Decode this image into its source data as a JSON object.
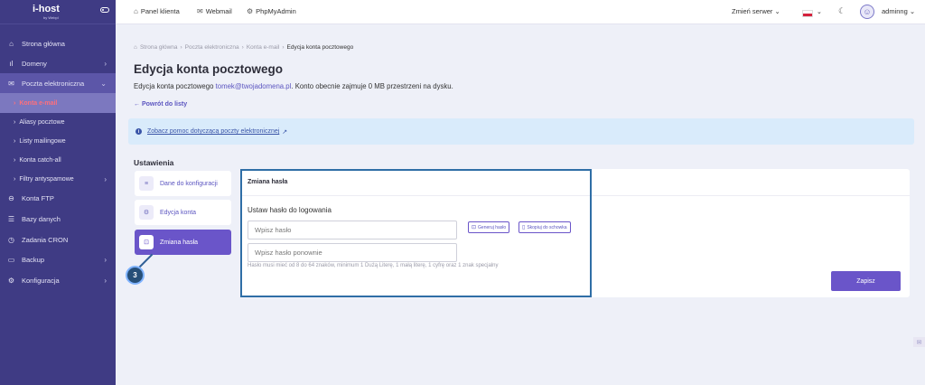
{
  "brand": {
    "logo": "i-host",
    "logo_sub": "by Webpl"
  },
  "sidebar": {
    "items": [
      {
        "label": "Strona główna",
        "icon": "home-icon"
      },
      {
        "label": "Domeny",
        "icon": "chart-icon"
      },
      {
        "label": "Poczta elektroniczna",
        "icon": "mail-icon"
      },
      {
        "label": "Konta e-mail"
      },
      {
        "label": "Aliasy pocztowe"
      },
      {
        "label": "Listy mailingowe"
      },
      {
        "label": "Konta catch-all"
      },
      {
        "label": "Filtry antyspamowe"
      },
      {
        "label": "Konta FTP",
        "icon": "ftp-icon"
      },
      {
        "label": "Bazy danych",
        "icon": "database-icon"
      },
      {
        "label": "Zadania CRON",
        "icon": "clock-icon"
      },
      {
        "label": "Backup",
        "icon": "backup-icon"
      },
      {
        "label": "Konfiguracja",
        "icon": "gear-icon"
      }
    ]
  },
  "topbar": {
    "panel_klienta": "Panel klienta",
    "webmail": "Webmail",
    "phpmyadmin": "PhpMyAdmin",
    "server_switch": "Zmień serwer",
    "username": "adminng"
  },
  "breadcrumb": {
    "home": "Strona główna",
    "level1": "Poczta elektroniczna",
    "level2": "Konta e-mail",
    "current": "Edycja konta pocztowego"
  },
  "page": {
    "title": "Edycja konta pocztowego",
    "desc_prefix": "Edycja konta pocztowego",
    "email": "tomek@twojadomena.pl",
    "desc_suffix": ". Konto obecnie zajmuje 0 MB przestrzeni na dysku.",
    "back_link": "← Powrót do listy",
    "info_link": "Zobacz pomoc dotyczącą poczty elektronicznej"
  },
  "settings": {
    "label": "Ustawienia",
    "tabs": [
      {
        "label": "Dane do konfiguracji",
        "icon": "list-icon"
      },
      {
        "label": "Edycja konta",
        "icon": "gear-icon"
      },
      {
        "label": "Zmiana hasła",
        "icon": "lock-icon"
      }
    ]
  },
  "password_panel": {
    "title": "Zmiana hasła",
    "field_label": "Ustaw hasło do logowania",
    "password_placeholder": "Wpisz hasło",
    "password_repeat_placeholder": "Wpisz hasło ponownie",
    "generate_label": "Generuj hasło",
    "copy_label": "Skopiuj do schowka",
    "hint": "Hasło musi mieć od 8 do 64 znaków, minimum 1 Dużą Literę, 1 małą literę, 1 cyfrę oraz 1 znak specjalny",
    "save_label": "Zapisz"
  },
  "annotation": {
    "step": "3"
  },
  "colors": {
    "sidebar": "#3f3b84",
    "accent": "#6a55c9",
    "active_text": "#ff6f7b",
    "highlight": "#2f6ea6"
  }
}
